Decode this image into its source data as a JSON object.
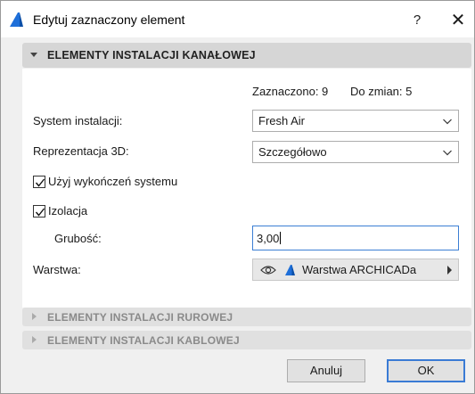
{
  "window": {
    "title": "Edytuj zaznaczony element",
    "help_label": "?",
    "close_label": "✕"
  },
  "sections": {
    "duct": {
      "label": "ELEMENTY INSTALACJI KANAŁOWEJ",
      "expanded": true
    },
    "pipe": {
      "label": "ELEMENTY INSTALACJI RUROWEJ",
      "expanded": false
    },
    "cable": {
      "label": "ELEMENTY INSTALACJI KABLOWEJ",
      "expanded": false
    }
  },
  "stats": {
    "selected": "Zaznaczono: 9",
    "to_change": "Do zmian: 5"
  },
  "fields": {
    "system": {
      "label": "System instalacji:",
      "value": "Fresh Air"
    },
    "rep3d": {
      "label": "Reprezentacja 3D:",
      "value": "Szczegółowo"
    },
    "use_finishes": {
      "label": "Użyj wykończeń systemu",
      "checked": true
    },
    "insulation": {
      "label": "Izolacja",
      "checked": true
    },
    "thickness": {
      "label": "Grubość:",
      "value": "3,00"
    },
    "layer": {
      "label": "Warstwa:",
      "value": "Warstwa ARCHICADa"
    }
  },
  "buttons": {
    "cancel": "Anuluj",
    "ok": "OK"
  },
  "colors": {
    "accent": "#3a7bd5",
    "app_icon": "#1e6fd9"
  }
}
